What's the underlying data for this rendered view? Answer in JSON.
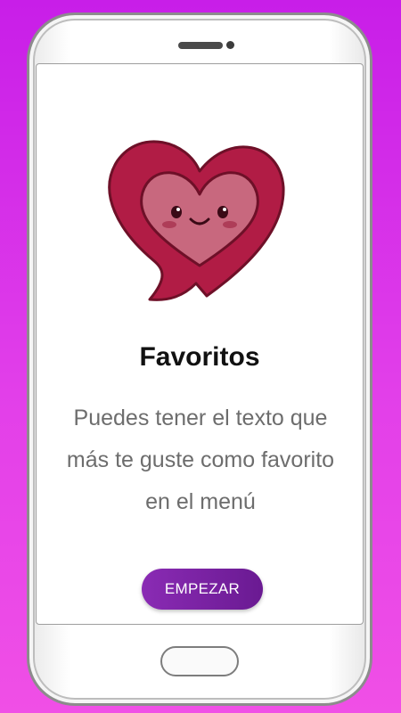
{
  "colors": {
    "background_top": "#c81ee8",
    "background_bottom": "#f04fe6",
    "heart_outer": "#b11c45",
    "heart_inner": "#c8687e",
    "button": "#7a22a4",
    "title": "#111111",
    "description": "#6d6d6d"
  },
  "illustration": {
    "icon": "kawaii-heart-speech-bubble-icon"
  },
  "onboarding": {
    "title": "Favoritos",
    "description": "Puedes tener el texto que más te guste como favorito en el menú",
    "button_label": "EMPEZAR"
  }
}
